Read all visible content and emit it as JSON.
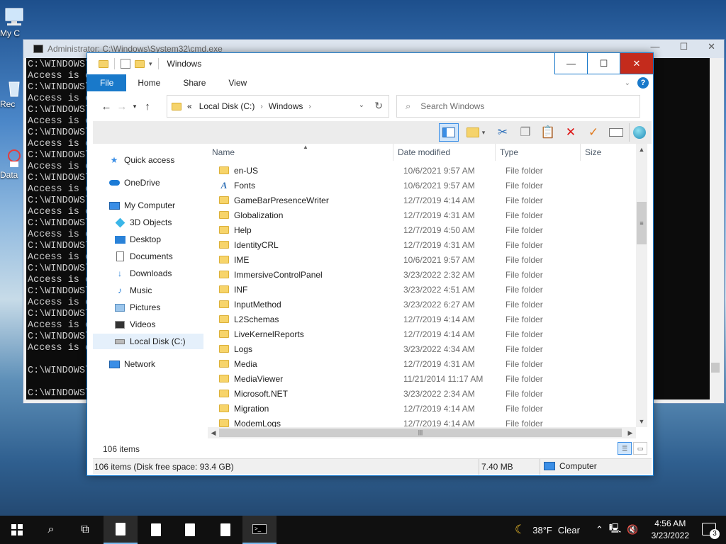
{
  "desktop": {
    "icons": [
      {
        "label": "My C",
        "icon": "computer-icon"
      },
      {
        "label": "Rec",
        "icon": "recycle-bin-icon"
      },
      {
        "label": "Data",
        "icon": "data-icon"
      }
    ]
  },
  "cmd": {
    "title": "Administrator: C:\\Windows\\System32\\cmd.exe",
    "lines": [
      "C:\\WINDOWS\\",
      "Access is d",
      "C:\\WINDOWS\\",
      "Access is d",
      "C:\\WINDOWS\\",
      "Access is d",
      "C:\\WINDOWS\\",
      "Access is d",
      "C:\\WINDOWS\\",
      "Access is d",
      "C:\\WINDOWS\\",
      "Access is d",
      "C:\\WINDOWS\\",
      "Access is d",
      "C:\\WINDOWS\\",
      "Access is d",
      "C:\\WINDOWS\\",
      "Access is d",
      "C:\\WINDOWS\\",
      "Access is d",
      "C:\\WINDOWS\\",
      "Access is d",
      "C:\\WINDOWS\\",
      "Access is d",
      "C:\\WINDOWS\\",
      "Access is d",
      "",
      "C:\\WINDOWS\\",
      "",
      "C:\\WINDOWS\\"
    ]
  },
  "explorer": {
    "title": "Windows",
    "ribbon_tabs": [
      "File",
      "Home",
      "Share",
      "View"
    ],
    "address": {
      "prefix": "«",
      "crumbs": [
        "Local Disk (C:)",
        "Windows"
      ]
    },
    "search_placeholder": "Search Windows",
    "nav": [
      {
        "label": "Quick access",
        "icon": "star-icon",
        "indent": 0,
        "selected": false
      },
      {
        "label": "OneDrive",
        "icon": "cloud-icon",
        "indent": 0,
        "selected": false
      },
      {
        "label": "My Computer",
        "icon": "computer-icon",
        "indent": 0,
        "selected": false
      },
      {
        "label": "3D Objects",
        "icon": "cube-icon",
        "indent": 1,
        "selected": false
      },
      {
        "label": "Desktop",
        "icon": "desktop-icon",
        "indent": 1,
        "selected": false
      },
      {
        "label": "Documents",
        "icon": "document-icon",
        "indent": 1,
        "selected": false
      },
      {
        "label": "Downloads",
        "icon": "download-icon",
        "indent": 1,
        "selected": false
      },
      {
        "label": "Music",
        "icon": "music-icon",
        "indent": 1,
        "selected": false
      },
      {
        "label": "Pictures",
        "icon": "picture-icon",
        "indent": 1,
        "selected": false
      },
      {
        "label": "Videos",
        "icon": "video-icon",
        "indent": 1,
        "selected": false
      },
      {
        "label": "Local Disk (C:)",
        "icon": "drive-icon",
        "indent": 1,
        "selected": true
      },
      {
        "label": "Network",
        "icon": "network-icon",
        "indent": 0,
        "selected": false
      }
    ],
    "columns": [
      "Name",
      "Date modified",
      "Type",
      "Size"
    ],
    "files": [
      {
        "name": "en-US",
        "date": "10/6/2021 9:57 AM",
        "type": "File folder",
        "icon": "folder-icon"
      },
      {
        "name": "Fonts",
        "date": "10/6/2021 9:57 AM",
        "type": "File folder",
        "icon": "font-icon"
      },
      {
        "name": "GameBarPresenceWriter",
        "date": "12/7/2019 4:14 AM",
        "type": "File folder",
        "icon": "folder-icon"
      },
      {
        "name": "Globalization",
        "date": "12/7/2019 4:31 AM",
        "type": "File folder",
        "icon": "folder-icon"
      },
      {
        "name": "Help",
        "date": "12/7/2019 4:50 AM",
        "type": "File folder",
        "icon": "folder-icon"
      },
      {
        "name": "IdentityCRL",
        "date": "12/7/2019 4:31 AM",
        "type": "File folder",
        "icon": "folder-icon"
      },
      {
        "name": "IME",
        "date": "10/6/2021 9:57 AM",
        "type": "File folder",
        "icon": "folder-icon"
      },
      {
        "name": "ImmersiveControlPanel",
        "date": "3/23/2022 2:32 AM",
        "type": "File folder",
        "icon": "folder-icon"
      },
      {
        "name": "INF",
        "date": "3/23/2022 4:51 AM",
        "type": "File folder",
        "icon": "folder-icon"
      },
      {
        "name": "InputMethod",
        "date": "3/23/2022 6:27 AM",
        "type": "File folder",
        "icon": "folder-icon"
      },
      {
        "name": "L2Schemas",
        "date": "12/7/2019 4:14 AM",
        "type": "File folder",
        "icon": "folder-icon"
      },
      {
        "name": "LiveKernelReports",
        "date": "12/7/2019 4:14 AM",
        "type": "File folder",
        "icon": "folder-icon"
      },
      {
        "name": "Logs",
        "date": "3/23/2022 4:34 AM",
        "type": "File folder",
        "icon": "folder-icon"
      },
      {
        "name": "Media",
        "date": "12/7/2019 4:31 AM",
        "type": "File folder",
        "icon": "folder-icon"
      },
      {
        "name": "MediaViewer",
        "date": "11/21/2014 11:17 AM",
        "type": "File folder",
        "icon": "folder-icon"
      },
      {
        "name": "Microsoft.NET",
        "date": "3/23/2022 2:34 AM",
        "type": "File folder",
        "icon": "folder-icon"
      },
      {
        "name": "Migration",
        "date": "12/7/2019 4:14 AM",
        "type": "File folder",
        "icon": "folder-icon"
      },
      {
        "name": "ModemLogs",
        "date": "12/7/2019 4:14 AM",
        "type": "File folder",
        "icon": "folder-icon"
      }
    ],
    "item_count": "106 items",
    "status": {
      "left": "106 items (Disk free space: 93.4 GB)",
      "size": "7.40 MB",
      "location": "Computer"
    }
  },
  "taskbar": {
    "weather": {
      "temp": "38°F",
      "condition": "Clear"
    },
    "time": "4:56 AM",
    "date": "3/23/2022",
    "notifications": "3",
    "cmd_icon_text": ">_"
  },
  "colors": {
    "accent": "#1979ca",
    "close": "#c42b1c",
    "folder": "#f7d46a"
  }
}
